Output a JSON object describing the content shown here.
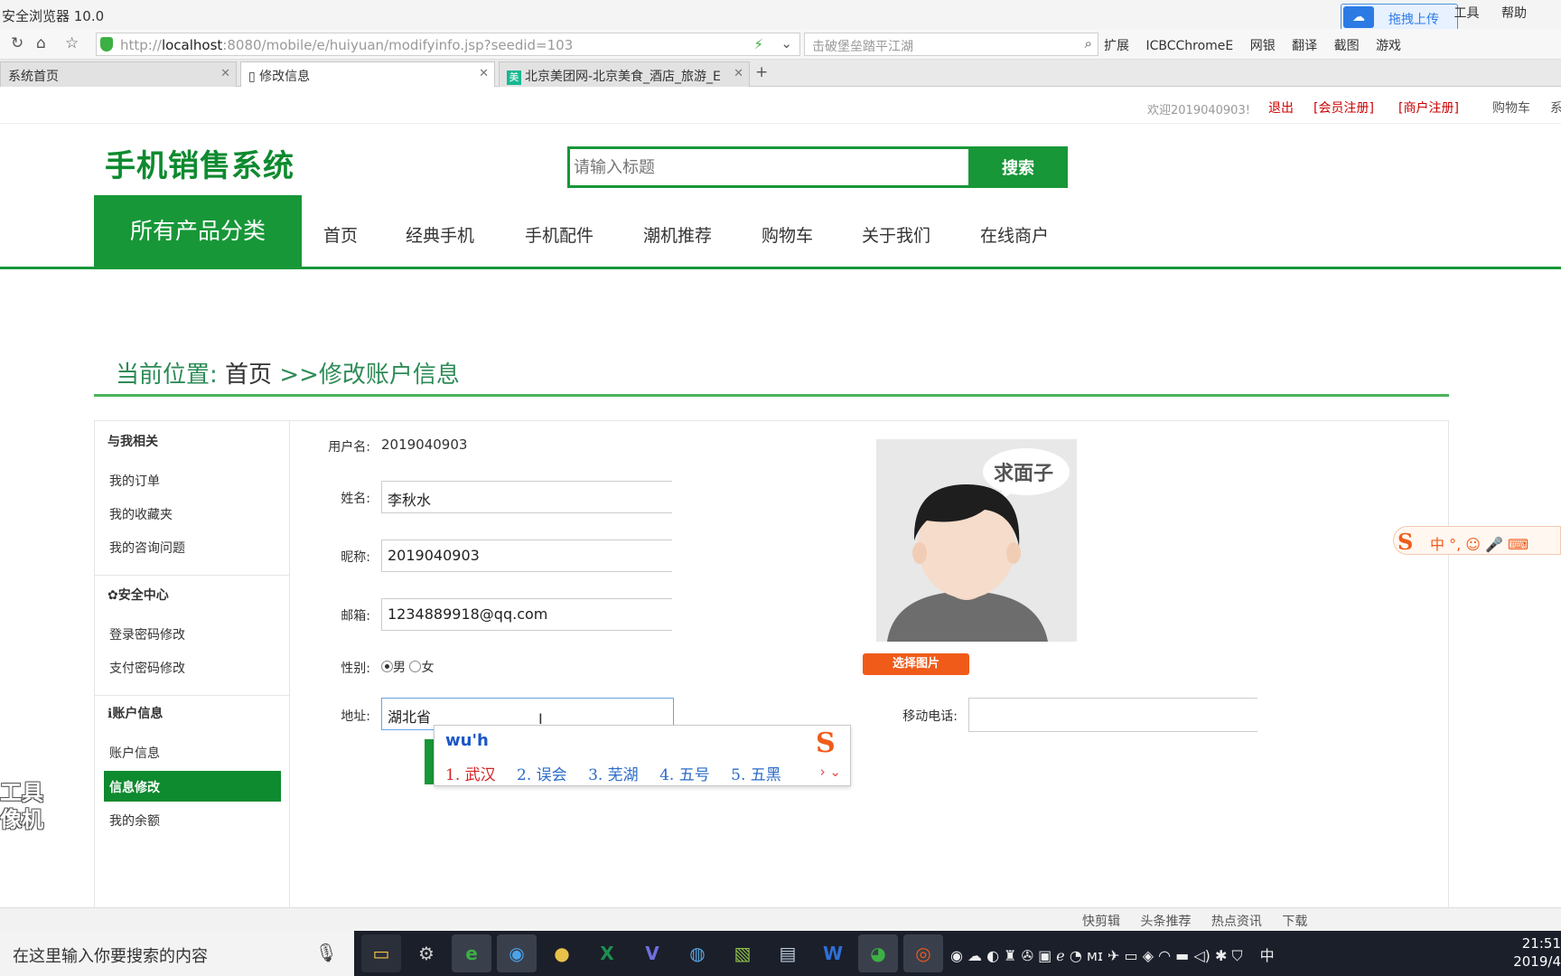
{
  "browser": {
    "title": "安全浏览器 10.0",
    "menus": [
      "工具",
      "帮助"
    ],
    "upload_label": "拖拽上传",
    "url_host": "localhost",
    "url_prefix": "http://",
    "url_rest": ":8080/mobile/e/huiyuan/modifyinfo.jsp?seedid=103",
    "search_text": "击破堡垒踏平江湖",
    "extensions": [
      "扩展",
      "ICBCChromeE",
      "网银",
      "翻译",
      "截图",
      "游戏"
    ],
    "tabs": [
      {
        "label": "系统首页"
      },
      {
        "label": "修改信息"
      },
      {
        "label": "北京美团网-北京美食_酒店_旅游_E"
      }
    ],
    "tab_icon_text": "美"
  },
  "topinfo": {
    "welcome": "欢迎2019040903!",
    "logout": "退出",
    "member_register": "[会员注册]",
    "merchant_register": "[商户注册]",
    "cart": "购物车",
    "extra": "系"
  },
  "site": {
    "logo": "手机销售系统",
    "search_placeholder": "请输入标题",
    "search_button": "搜索",
    "category_button": "所有产品分类",
    "nav": [
      "首页",
      "经典手机",
      "手机配件",
      "潮机推荐",
      "购物车",
      "关于我们",
      "在线商户"
    ]
  },
  "breadcrumb": {
    "prefix": "当前位置:",
    "home": "首页",
    "current": ">>修改账户信息"
  },
  "sidebar": {
    "sections": [
      {
        "title": "与我相关",
        "items": [
          "我的订单",
          "我的收藏夹",
          "我的咨询问题"
        ]
      },
      {
        "title": "✿安全中心",
        "items": [
          "登录密码修改",
          "支付密码修改"
        ]
      },
      {
        "title": "ℹ账户信息",
        "items": [
          "账户信息",
          "信息修改",
          "我的余额"
        ]
      }
    ]
  },
  "form": {
    "username_label": "用户名:",
    "username": "2019040903",
    "name_label": "姓名:",
    "name": "李秋水",
    "nickname_label": "昵称:",
    "nickname": "2019040903",
    "email_label": "邮箱:",
    "email": "1234889918@qq.com",
    "gender_label": "性别:",
    "gender_male": "男",
    "gender_female": "女",
    "address_label": "地址:",
    "address": "湖北省",
    "phone_label": "移动电话:",
    "phone": "",
    "choose_image": "选择图片",
    "avatar_bubble": "求面子"
  },
  "ime": {
    "composition": "wu'h",
    "candidates": [
      "1. 武汉",
      "2. 误会",
      "3. 芜湖",
      "4. 五号",
      "5. 五黑"
    ],
    "logo": "S",
    "bar_text": "中 °, ☺ 🎤 ⌨"
  },
  "watermark": [
    "工具",
    "像机"
  ],
  "statusbar": [
    "快剪辑",
    "头条推荐",
    "热点资讯",
    "下载"
  ],
  "taskbar": {
    "search_placeholder": "在这里输入你要搜索的内容",
    "tray": [
      "中"
    ],
    "time": "21:51",
    "date": "2019/4"
  },
  "colors": {
    "brand_green": "#179738",
    "accent_orange": "#f05b1a",
    "link_red": "#cc0000"
  }
}
